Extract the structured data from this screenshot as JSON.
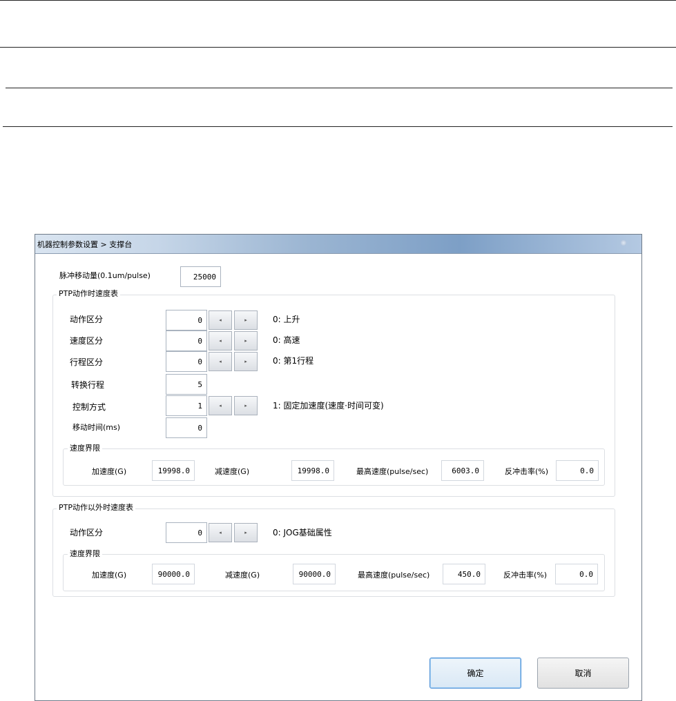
{
  "window": {
    "title": "机器控制参数设置 > 支撑台"
  },
  "pulse": {
    "label": "脉冲移动量(0.1um/pulse)",
    "value": "25000"
  },
  "ptp": {
    "group_title": "PTP动作时速度表",
    "rows": [
      {
        "label": "动作区分",
        "value": "0",
        "desc": "0: 上升"
      },
      {
        "label": "速度区分",
        "value": "0",
        "desc": "0: 高速"
      },
      {
        "label": "行程区分",
        "value": "0",
        "desc": "0: 第1行程"
      },
      {
        "label": "转换行程",
        "value": "5"
      },
      {
        "label": "控制方式",
        "value": "1",
        "desc": "1: 固定加速度(速度·时间可变)"
      },
      {
        "label": "移动时间(ms)",
        "value": "0"
      }
    ],
    "limits": {
      "title": "速度界限",
      "accel_label": "加速度(G)",
      "accel": "19998.0",
      "decel_label": "减速度(G)",
      "decel": "19998.0",
      "maxspeed_label": "最高速度(pulse/sec)",
      "maxspeed": "6003.0",
      "recoil_label": "反冲击率(%)",
      "recoil": "0.0"
    }
  },
  "nonptp": {
    "group_title": "PTP动作以外时速度表",
    "rows": [
      {
        "label": "动作区分",
        "value": "0",
        "desc": "0: JOG基础属性"
      }
    ],
    "limits": {
      "title": "速度界限",
      "accel_label": "加速度(G)",
      "accel": "90000.0",
      "decel_label": "减速度(G)",
      "decel": "90000.0",
      "maxspeed_label": "最高速度(pulse/sec)",
      "maxspeed": "450.0",
      "recoil_label": "反冲击率(%)",
      "recoil": "0.0"
    }
  },
  "spin": {
    "left_glyph": "◂",
    "right_glyph": "▸"
  },
  "buttons": {
    "ok": "确定",
    "cancel": "取消"
  }
}
